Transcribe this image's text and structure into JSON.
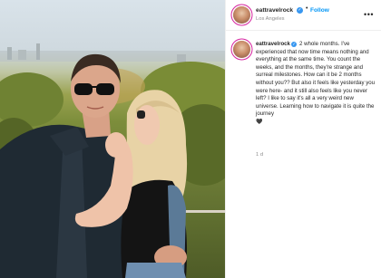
{
  "post": {
    "username": "eattravelrock",
    "verified_glyph": "✓",
    "follow_label": "Follow",
    "separator": "•",
    "location": "Los Angeles",
    "more_glyph": "•••",
    "caption_text": "2 whole months. I've experienced that now time means nothing and everything at the same time. You count the weeks, and the months, they're strange and surreal milestones. How can it be 2 months without you?? But also it feels like yesterday you were here- and it still also feels like you never left? I like to say it's all a very weird new universe. Learning how to navigate it is quite the journey",
    "caption_emoji": "🖤",
    "time_ago": "1 d"
  },
  "icons": {
    "avatar": "profile-avatar",
    "verified": "verified-badge-icon",
    "more": "more-options-icon",
    "emoji": "black-heart-emoji"
  },
  "colors": {
    "verified": "#3897f0",
    "follow": "#0095f6",
    "muted": "#8e8e8e",
    "text": "#262626"
  }
}
